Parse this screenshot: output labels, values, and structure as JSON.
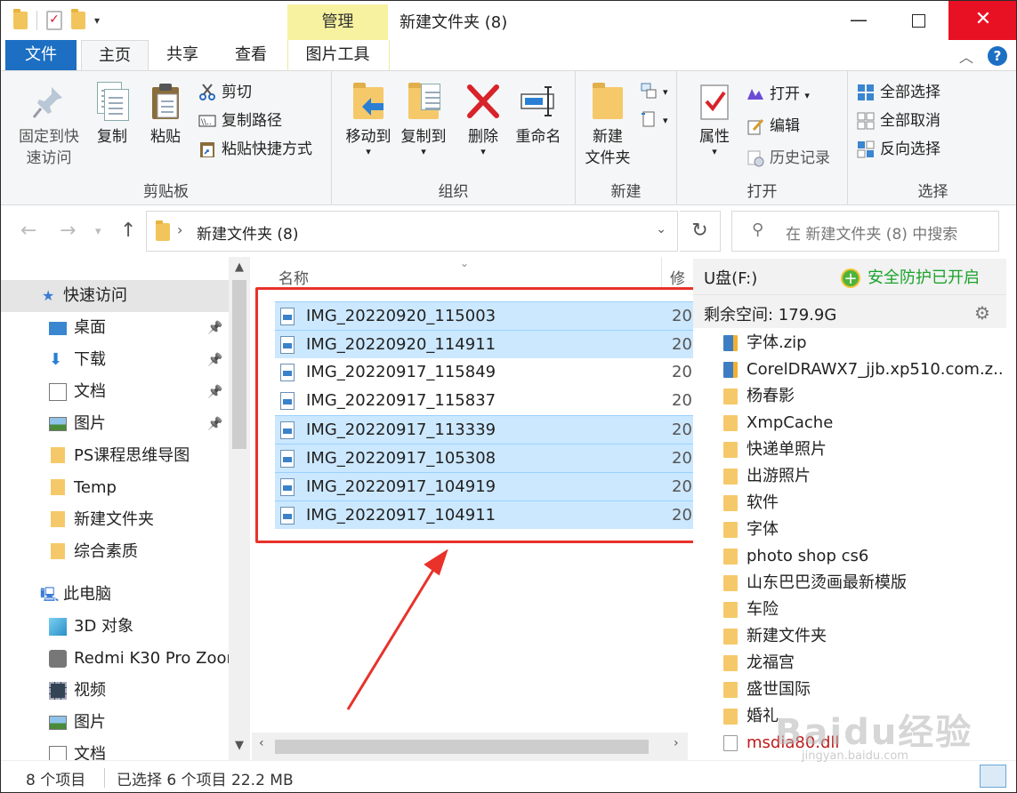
{
  "window": {
    "title": "新建文件夹 (8)",
    "context_tab": "管理",
    "minimize": "—",
    "close": "✕"
  },
  "tabs": [
    "文件",
    "主页",
    "共享",
    "查看",
    "图片工具"
  ],
  "ribbon": {
    "clipboard": {
      "label": "剪贴板",
      "pin": "固定到快速访问",
      "pin_line1": "固定到快",
      "pin_line2": "速访问",
      "copy": "复制",
      "paste": "粘贴",
      "cut": "剪切",
      "copy_path": "复制路径",
      "paste_shortcut": "粘贴快捷方式"
    },
    "organize": {
      "label": "组织",
      "move_to": "移动到",
      "copy_to": "复制到",
      "delete": "删除",
      "rename": "重命名"
    },
    "new": {
      "label": "新建",
      "new_folder_line1": "新建",
      "new_folder_line2": "文件夹"
    },
    "open": {
      "label": "打开",
      "properties": "属性",
      "open": "打开",
      "edit": "编辑",
      "history": "历史记录"
    },
    "select": {
      "label": "选择",
      "select_all": "全部选择",
      "select_none": "全部取消",
      "invert": "反向选择"
    }
  },
  "address": {
    "path": "新建文件夹 (8)",
    "search_placeholder": "在 新建文件夹 (8) 中搜索"
  },
  "navpane": {
    "quick_access": "快速访问",
    "items": [
      {
        "label": "桌面",
        "pinned": true,
        "icon": "desktop-icon"
      },
      {
        "label": "下载",
        "pinned": true,
        "icon": "download-icon"
      },
      {
        "label": "文档",
        "pinned": true,
        "icon": "documents-icon"
      },
      {
        "label": "图片",
        "pinned": true,
        "icon": "pictures-icon"
      },
      {
        "label": "PS课程思维导图",
        "pinned": false,
        "icon": "folder-icon"
      },
      {
        "label": "Temp",
        "pinned": false,
        "icon": "folder-icon"
      },
      {
        "label": "新建文件夹",
        "pinned": false,
        "icon": "folder-icon"
      },
      {
        "label": "综合素质",
        "pinned": false,
        "icon": "folder-icon"
      }
    ],
    "this_pc": "此电脑",
    "pc_items": [
      {
        "label": "3D 对象",
        "icon": "3d-objects-icon"
      },
      {
        "label": "Redmi K30 Pro Zoor",
        "icon": "camera-icon"
      },
      {
        "label": "视频",
        "icon": "videos-icon"
      },
      {
        "label": "图片",
        "icon": "pictures-icon"
      },
      {
        "label": "文档",
        "icon": "documents-icon"
      }
    ]
  },
  "filelist": {
    "col_name": "名称",
    "col_modified": "修",
    "files": [
      {
        "name": "IMG_20220920_115003",
        "date": "20",
        "selected": true
      },
      {
        "name": "IMG_20220920_114911",
        "date": "20",
        "selected": true
      },
      {
        "name": "IMG_20220917_115849",
        "date": "20",
        "selected": false
      },
      {
        "name": "IMG_20220917_115837",
        "date": "20",
        "selected": false
      },
      {
        "name": "IMG_20220917_113339",
        "date": "20",
        "selected": true
      },
      {
        "name": "IMG_20220917_105308",
        "date": "20",
        "selected": true
      },
      {
        "name": "IMG_20220917_104919",
        "date": "20",
        "selected": true
      },
      {
        "name": "IMG_20220917_104911",
        "date": "20",
        "selected": true
      }
    ]
  },
  "udisk": {
    "name": "U盘(F:)",
    "safety": "安全防护已开启",
    "free_space": "剩余空间: 179.9G",
    "items": [
      {
        "label": "字体.zip",
        "type": "zip"
      },
      {
        "label": "CorelDRAWX7_jjb.xp510.com.z...",
        "type": "zip"
      },
      {
        "label": "杨春影",
        "type": "folder"
      },
      {
        "label": "XmpCache",
        "type": "folder"
      },
      {
        "label": "快递单照片",
        "type": "folder"
      },
      {
        "label": "出游照片",
        "type": "folder"
      },
      {
        "label": "软件",
        "type": "folder"
      },
      {
        "label": "字体",
        "type": "folder"
      },
      {
        "label": "photo shop cs6",
        "type": "folder"
      },
      {
        "label": "山东巴巴烫画最新模版",
        "type": "folder"
      },
      {
        "label": "车险",
        "type": "folder"
      },
      {
        "label": "新建文件夹",
        "type": "folder"
      },
      {
        "label": "龙福宫",
        "type": "folder"
      },
      {
        "label": "盛世国际",
        "type": "folder"
      },
      {
        "label": "婚礼",
        "type": "folder"
      },
      {
        "label": "msdia80.dll",
        "type": "dll"
      }
    ]
  },
  "status": {
    "count": "8 个项目",
    "selected": "已选择 6 个项目  22.2 MB"
  },
  "watermark": {
    "text": "Baidu经验",
    "sub": "jingyan.baidu.com"
  },
  "colors": {
    "accent": "#1c6fc2",
    "selection": "#cce8ff",
    "highlight_box": "#e8322a",
    "close_button": "#e81123",
    "safe_green": "#1aa32b"
  }
}
